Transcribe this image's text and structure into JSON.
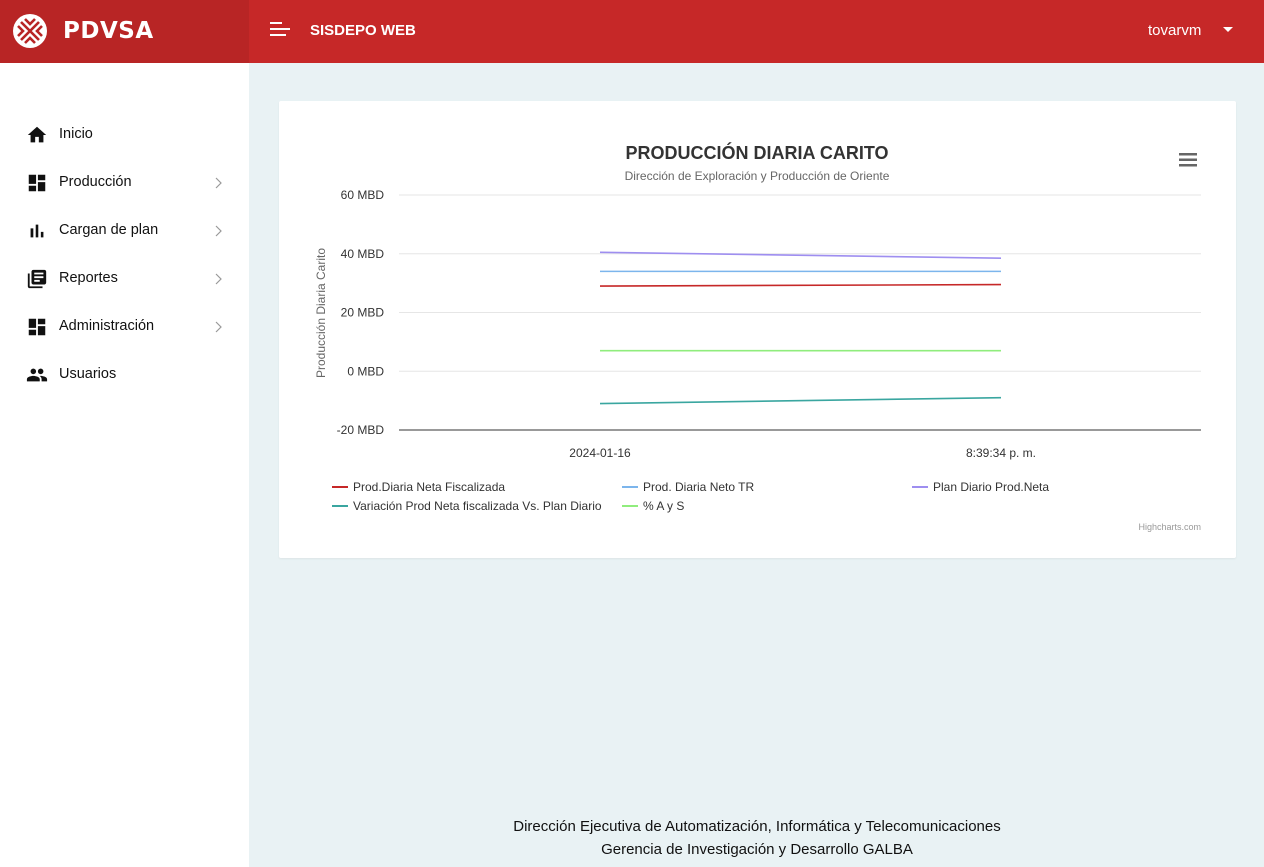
{
  "header": {
    "brand": "PDVSA",
    "app_title": "SISDEPO WEB",
    "user": "tovarvm"
  },
  "sidebar": {
    "items": [
      {
        "label": "Inicio",
        "icon": "home-icon",
        "has_submenu": false
      },
      {
        "label": "Producción",
        "icon": "dashboard-icon",
        "has_submenu": true
      },
      {
        "label": "Cargan de plan",
        "icon": "bar-chart-icon",
        "has_submenu": true
      },
      {
        "label": "Reportes",
        "icon": "library-books-icon",
        "has_submenu": true
      },
      {
        "label": "Administración",
        "icon": "dashboard-icon",
        "has_submenu": true
      },
      {
        "label": "Usuarios",
        "icon": "people-icon",
        "has_submenu": false
      }
    ]
  },
  "chart_data": {
    "type": "line",
    "title": "PRODUCCIÓN DIARIA CARITO",
    "subtitle": "Dirección de Exploración y Producción de Oriente",
    "ylabel": "Producción Diaria Carito",
    "xlabel": "",
    "ylim": [
      -20,
      60
    ],
    "yticks": [
      "60 MBD",
      "40 MBD",
      "20 MBD",
      "0 MBD",
      "-20 MBD"
    ],
    "ytick_values": [
      60,
      40,
      20,
      0,
      -20
    ],
    "categories": [
      "2024-01-16",
      "8:39:34 p. m."
    ],
    "grid": true,
    "legend_position": "bottom",
    "credits": "Highcharts.com",
    "series": [
      {
        "name": "Prod.Diaria Neta Fiscalizada",
        "color": "#c62828",
        "values": [
          29,
          29.5
        ]
      },
      {
        "name": "Prod. Diaria Neto TR",
        "color": "#7cb5ec",
        "values": [
          34,
          34
        ]
      },
      {
        "name": "Plan Diario Prod.Neta",
        "color": "#9e8ef0",
        "values": [
          40.5,
          38.5
        ]
      },
      {
        "name": "Variación Prod Neta fiscalizada Vs. Plan Diario",
        "color": "#3aa6a0",
        "values": [
          -11,
          -9
        ]
      },
      {
        "name": "% A y S",
        "color": "#90ed7d",
        "values": [
          7,
          7
        ]
      }
    ]
  },
  "footer": {
    "line1": "Dirección Ejecutiva de Automatización, Informática y Telecomunicaciones",
    "line2": "Gerencia de Investigación y Desarrollo GALBA"
  }
}
